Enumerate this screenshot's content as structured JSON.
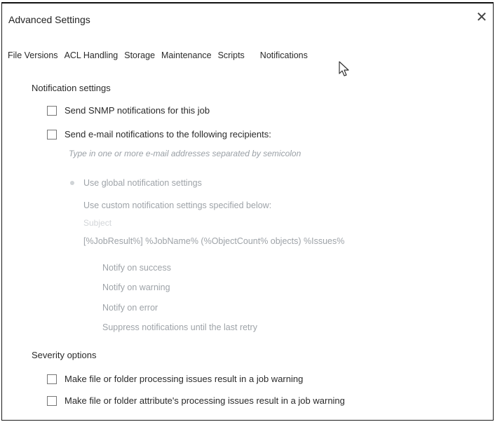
{
  "dialog": {
    "title": "Advanced Settings",
    "close_glyph": "✕"
  },
  "tabs": [
    {
      "label": "File Versions"
    },
    {
      "label": "ACL Handling"
    },
    {
      "label": "Storage"
    },
    {
      "label": "Maintenance"
    },
    {
      "label": "Scripts"
    },
    {
      "label": "Notifications",
      "active": true
    }
  ],
  "notification_settings": {
    "heading": "Notification settings",
    "snmp_label": "Send SNMP notifications for this job",
    "snmp_checked": false,
    "email_label": "Send e-mail notifications to the following recipients:",
    "email_checked": false,
    "email_placeholder": "Type in one or more e-mail addresses separated by semicolon",
    "use_global_label": "Use global notification settings",
    "use_custom_label": "Use custom notification settings specified below:",
    "subject_label": "Subject",
    "subject_value": "[%JobResult%] %JobName% (%ObjectCount% objects) %Issues%",
    "notify_success": "Notify on success",
    "notify_warning": "Notify on warning",
    "notify_error": "Notify on error",
    "suppress": "Suppress notifications until the last retry"
  },
  "severity": {
    "heading": "Severity options",
    "file_issues_label": "Make file or folder processing issues result in a job warning",
    "file_issues_checked": false,
    "attr_issues_label": "Make file or folder attribute's processing issues result in a job warning",
    "attr_issues_checked": false
  },
  "icons": {
    "close": "close-icon",
    "cursor": "mouse-pointer-icon"
  }
}
